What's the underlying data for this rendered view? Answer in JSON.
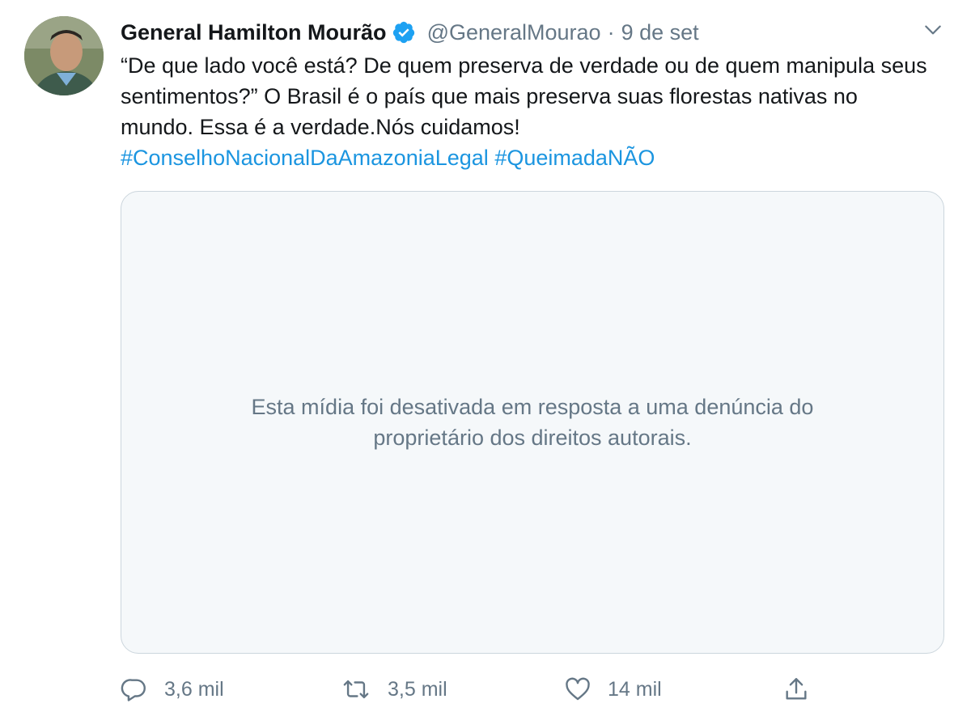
{
  "author": {
    "name": "General Hamilton Mourão",
    "handle": "@GeneralMourao",
    "separator": "·",
    "time": "9 de set",
    "verified": true
  },
  "tweet": {
    "text": "“De que lado você está? De quem preserva de verdade ou de quem manipula seus sentimentos?” O Brasil é o país que mais preserva suas florestas nativas no mundo. Essa é a verdade.Nós cuidamos!",
    "hashtags": [
      "#ConselhoNacionalDaAmazoniaLegal",
      "#QueimadaNÃO"
    ]
  },
  "media": {
    "message_line1": "Esta mídia foi desativada em resposta a uma denúncia do",
    "message_line2": "proprietário dos direitos autorais."
  },
  "actions": {
    "replies": "3,6 mil",
    "retweets": "3,5 mil",
    "likes": "14 mil"
  },
  "icons": {
    "avatar": "profile-photo",
    "verified": "verified-badge-icon",
    "menu": "chevron-down-icon",
    "reply": "reply-icon",
    "retweet": "retweet-icon",
    "like": "heart-icon",
    "share": "share-icon"
  },
  "colors": {
    "link": "#1b95e0",
    "secondary_text": "#657786",
    "media_bg": "#f5f8fa",
    "border": "#ccd6dd",
    "verified": "#1da1f2"
  }
}
